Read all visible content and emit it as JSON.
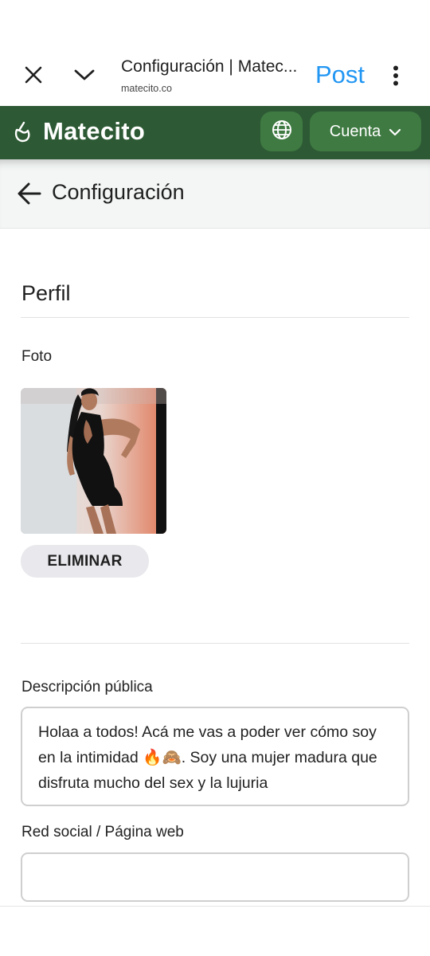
{
  "browser": {
    "title": "Configuración | Matec...",
    "url": "matecito.co",
    "post_label": "Post"
  },
  "header": {
    "brand": "Matecito",
    "account_label": "Cuenta"
  },
  "page": {
    "title": "Configuración"
  },
  "profile": {
    "section_title": "Perfil",
    "photo_label": "Foto",
    "delete_label": "ELIMINAR",
    "description_label": "Descripción pública",
    "description_value": "Holaa a todos! Acá me vas a poder ver cómo soy en la intimidad 🔥🙈. Soy una mujer madura que disfruta mucho del sex y la lujuria",
    "social_label": "Red social / Página web",
    "social_value": ""
  },
  "icons": {
    "close": "close-icon",
    "chevron": "chevron-down-icon",
    "menu": "more-vert-icon",
    "logo": "mate-cup-icon",
    "globe": "globe-icon",
    "back": "arrow-back-icon"
  },
  "colors": {
    "header_green": "#2d5a34",
    "button_green": "#3f7a42",
    "post_blue": "#2196f3"
  }
}
